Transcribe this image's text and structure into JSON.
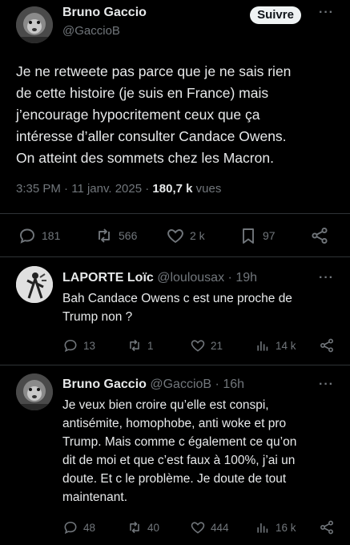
{
  "main_tweet": {
    "author_name": "Bruno Gaccio",
    "author_handle": "@GaccioB",
    "follow_label": "Suivre",
    "more_label": "···",
    "text_lines": [
      "Je ne retweete pas parce que je ne sais rien",
      "de cette histoire (je suis en France) mais",
      "j’encourage hypocritement ceux que ça",
      "intéresse d’aller consulter Candace Owens.",
      "On atteint des sommets chez les Macron."
    ],
    "time": "3:35 PM",
    "date": "11 janv. 2025",
    "views_count": "180,7 k",
    "views_label": "vues",
    "actions": {
      "replies": "181",
      "retweets": "566",
      "likes": "2 k",
      "bookmarks": "97"
    }
  },
  "replies": [
    {
      "author_name": "LAPORTE Loïc",
      "author_handle": "@loulousax",
      "time": "19h",
      "more_label": "···",
      "text_lines": [
        "Bah Candace Owens c est une proche de",
        "Trump non ?"
      ],
      "actions": {
        "replies": "13",
        "retweets": "1",
        "likes": "21",
        "views": "14 k"
      }
    },
    {
      "author_name": "Bruno Gaccio",
      "author_handle": "@GaccioB",
      "time": "16h",
      "more_label": "···",
      "text_lines": [
        "Je veux bien croire qu’elle est conspi,",
        "antisémite, homophobe, anti woke et pro",
        "Trump. Mais comme c également ce qu’on",
        "dit de moi et que c’est faux à 100%, j’ai un",
        "doute. Et c le problème. Je doute de tout",
        "maintenant."
      ],
      "actions": {
        "replies": "48",
        "retweets": "40",
        "likes": "444",
        "views": "16 k"
      }
    }
  ],
  "colors": {
    "background": "#000000",
    "text": "#e7e9ea",
    "muted": "#71767b",
    "divider": "#2f3336"
  }
}
